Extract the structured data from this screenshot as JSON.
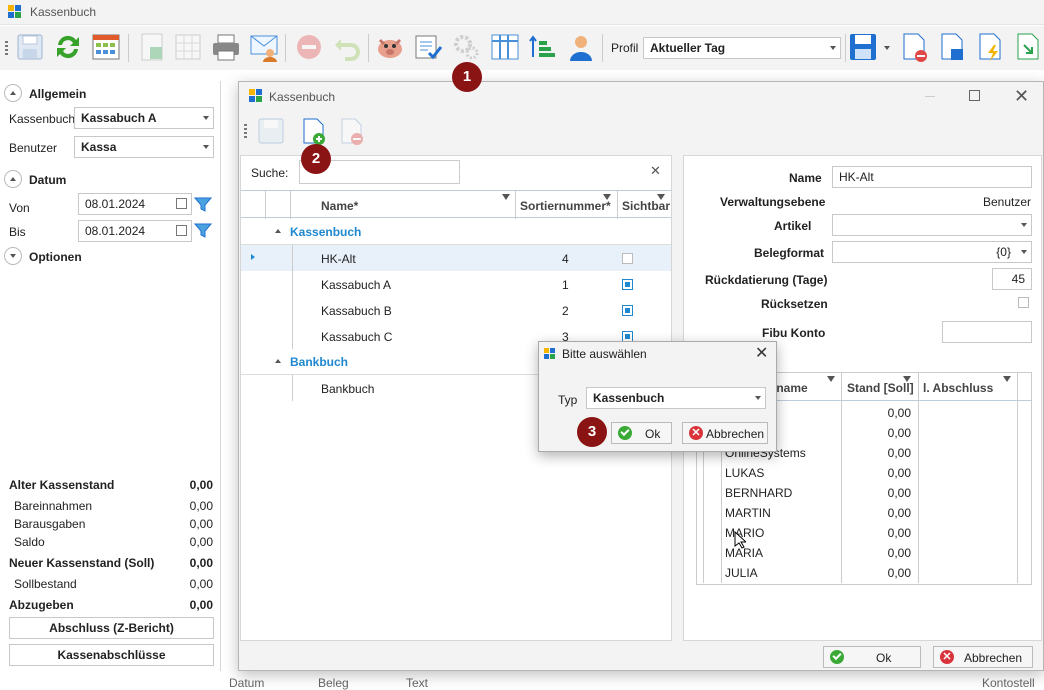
{
  "app": {
    "title": "Kassenbuch"
  },
  "toolbar": {
    "profil_label": "Profil",
    "profil_value": "Aktueller Tag"
  },
  "left": {
    "allgemein": "Allgemein",
    "kassenbuch_label": "Kassenbuch",
    "kassenbuch_value": "Kassabuch A",
    "benutzer_label": "Benutzer",
    "benutzer_value": "Kassa",
    "datum": "Datum",
    "von_label": "Von",
    "von_value": "08.01.2024",
    "bis_label": "Bis",
    "bis_value": "08.01.2024",
    "optionen": "Optionen",
    "summary": [
      {
        "label": "Alter Kassenstand",
        "value": "0,00",
        "bold": true
      },
      {
        "label": "Bareinnahmen",
        "value": "0,00",
        "bold": false
      },
      {
        "label": "Barausgaben",
        "value": "0,00",
        "bold": false
      },
      {
        "label": "Saldo",
        "value": "0,00",
        "bold": false
      },
      {
        "label": "Neuer Kassenstand (Soll)",
        "value": "0,00",
        "bold": true
      },
      {
        "label": "Sollbestand",
        "value": "0,00",
        "bold": false
      },
      {
        "label": "Abzugeben",
        "value": "0,00",
        "bold": true
      }
    ],
    "abschluss_btn": "Abschluss (Z-Bericht)",
    "kassenabschluesse_btn": "Kassenabschlüsse"
  },
  "bottom_cols": [
    "Datum",
    "Beleg",
    "Text",
    "Kontostell"
  ],
  "win": {
    "title": "Kassenbuch",
    "search_label": "Suche:",
    "cols": {
      "name": "Name*",
      "sort": "Sortiernummer*",
      "visible": "Sichtbar"
    },
    "groups": [
      {
        "name": "Kassenbuch",
        "rows": [
          {
            "name": "HK-Alt",
            "sort": "4",
            "visible": false
          },
          {
            "name": "Kassabuch A",
            "sort": "1",
            "visible": true
          },
          {
            "name": "Kassabuch B",
            "sort": "2",
            "visible": true
          },
          {
            "name": "Kassabuch C",
            "sort": "3",
            "visible": true
          }
        ]
      },
      {
        "name": "Bankbuch",
        "rows": [
          {
            "name": "Bankbuch",
            "sort": "",
            "visible": false
          }
        ]
      }
    ],
    "detail": {
      "name_label": "Name",
      "name_value": "HK-Alt",
      "verwaltung_label": "Verwaltungsebene",
      "verwaltung_value": "Benutzer",
      "artikel_label": "Artikel",
      "artikel_value": "",
      "belegformat_label": "Belegformat",
      "belegformat_value": "{0}",
      "rueck_label": "Rückdatierung (Tage)",
      "rueck_value": "45",
      "ruecksetzen_label": "Rücksetzen",
      "fibu_label": "Fibu Konto",
      "fibu_value": "",
      "grid_cols": [
        "Benutzername",
        "Stand [Soll]",
        "l. Abschluss"
      ],
      "users": [
        {
          "name": "OR",
          "stand": "0,00"
        },
        {
          "name": "",
          "stand": "0,00"
        },
        {
          "name": "OnlineSystems",
          "stand": "0,00"
        },
        {
          "name": "LUKAS",
          "stand": "0,00"
        },
        {
          "name": "BERNHARD",
          "stand": "0,00"
        },
        {
          "name": "MARTIN",
          "stand": "0,00"
        },
        {
          "name": "MARIO",
          "stand": "0,00"
        },
        {
          "name": "MARIA",
          "stand": "0,00"
        },
        {
          "name": "JULIA",
          "stand": "0,00"
        }
      ]
    },
    "ok": "Ok",
    "cancel": "Abbrechen"
  },
  "dialog": {
    "title": "Bitte auswählen",
    "typ_label": "Typ",
    "typ_value": "Kassenbuch",
    "ok": "Ok",
    "cancel": "Abbrechen"
  },
  "badges": [
    "1",
    "2",
    "3"
  ]
}
